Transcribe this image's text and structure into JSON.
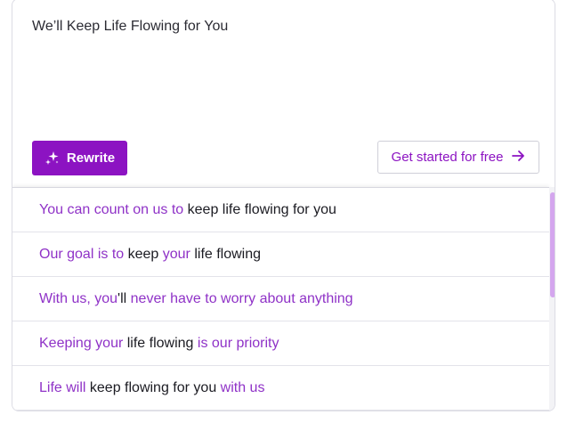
{
  "editor": {
    "text": "We’ll Keep Life Flowing for You"
  },
  "actions": {
    "rewrite_label": "Rewrite",
    "get_started_label": "Get started for free"
  },
  "colors": {
    "accent": "#8c13c2",
    "suggestion_highlight": "#8f32c7",
    "scroll_thumb": "#d4a6ee"
  },
  "suggestions": [
    {
      "parts": [
        {
          "t": "You can count on us to ",
          "hl": true
        },
        {
          "t": "keep life flowing for you",
          "hl": false
        }
      ]
    },
    {
      "parts": [
        {
          "t": "Our goal is to ",
          "hl": true
        },
        {
          "t": "keep ",
          "hl": false
        },
        {
          "t": "your ",
          "hl": true
        },
        {
          "t": "life flowing",
          "hl": false
        }
      ]
    },
    {
      "parts": [
        {
          "t": "With us, you",
          "hl": true
        },
        {
          "t": "'ll ",
          "hl": false
        },
        {
          "t": "never have to worry about anything",
          "hl": true
        }
      ]
    },
    {
      "parts": [
        {
          "t": "Keeping your ",
          "hl": true
        },
        {
          "t": "life flowing ",
          "hl": false
        },
        {
          "t": "is our priority",
          "hl": true
        }
      ]
    },
    {
      "parts": [
        {
          "t": "Life will ",
          "hl": true
        },
        {
          "t": "keep flowing for you ",
          "hl": false
        },
        {
          "t": "with us",
          "hl": true
        }
      ]
    }
  ]
}
